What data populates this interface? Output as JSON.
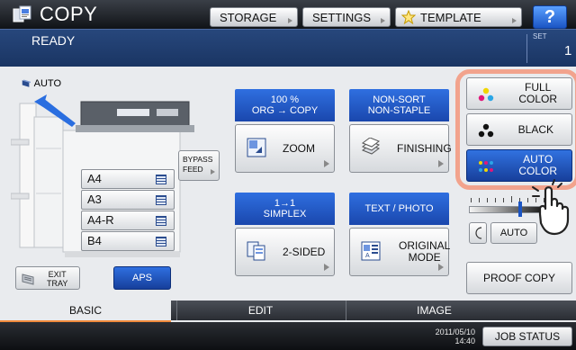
{
  "header": {
    "title": "COPY",
    "buttons": [
      {
        "label": "STORAGE"
      },
      {
        "label": "SETTINGS"
      },
      {
        "label": "TEMPLATE"
      }
    ],
    "help_label": "?"
  },
  "status": {
    "message": "READY",
    "set_label": "SET",
    "set_count": "1"
  },
  "left_panel": {
    "auto_label": "AUTO",
    "bypass_label_1": "BYPASS",
    "bypass_label_2": "FEED",
    "trays": [
      "A4",
      "A3",
      "A4-R",
      "B4"
    ],
    "exit_tray_label_1": "EXIT",
    "exit_tray_label_2": "TRAY",
    "aps_label": "APS"
  },
  "functions": {
    "zoom": {
      "header_1": "100 %",
      "header_2": "ORG → COPY",
      "button": "ZOOM"
    },
    "finishing": {
      "header_1": "NON-SORT",
      "header_2": "NON-STAPLE",
      "button": "FINISHING"
    },
    "sided": {
      "header_1": "1→1",
      "header_2": "SIMPLEX",
      "button": "2-SIDED"
    },
    "original_mode": {
      "header_1": "TEXT / PHOTO",
      "button_1": "ORIGINAL",
      "button_2": "MODE"
    }
  },
  "color_modes": [
    {
      "label_1": "FULL",
      "label_2": "COLOR",
      "active": false
    },
    {
      "label_1": "BLACK",
      "label_2": "",
      "active": false
    },
    {
      "label_1": "AUTO",
      "label_2": "COLOR",
      "active": true
    }
  ],
  "density": {
    "auto_label": "AUTO",
    "level_fraction": 0.7
  },
  "proof_copy_label": "PROOF COPY",
  "tabs": [
    {
      "label": "BASIC",
      "active": true
    },
    {
      "label": "EDIT",
      "active": false
    },
    {
      "label": "IMAGE",
      "active": false
    }
  ],
  "footer": {
    "date": "2011/05/10",
    "time": "14:40",
    "job_status_label": "JOB STATUS"
  },
  "colors": {
    "accent_blue": "#1b55c4",
    "highlight_frame": "#f2a38d",
    "tab_underline": "#f08a3c"
  }
}
